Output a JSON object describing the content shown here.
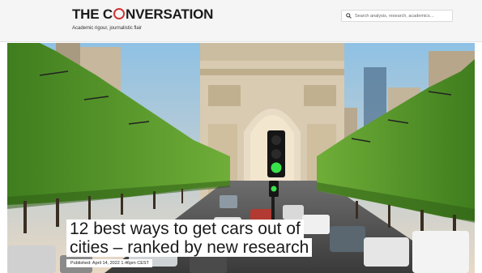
{
  "header": {
    "logo_part1": "THE C",
    "logo_part2": "NVERSATION",
    "tagline": "Academic rigour, journalistic flair",
    "search": {
      "placeholder": "Search analysis, research, academics…"
    }
  },
  "article": {
    "headline_line1": "12 best ways to get cars out of",
    "headline_line2": "cities – ranked by new research",
    "published": "Published: April 14, 2022 1.46pm CEST"
  },
  "colors": {
    "brand_red": "#cf3535",
    "header_bg": "#f5f5f5",
    "sky": "#9ec9e6",
    "trees": "#5a9a2e",
    "traffic_light_green": "#39e24a"
  },
  "icons": {
    "search": "search-icon",
    "logo_ring": "logo-ring-icon"
  }
}
